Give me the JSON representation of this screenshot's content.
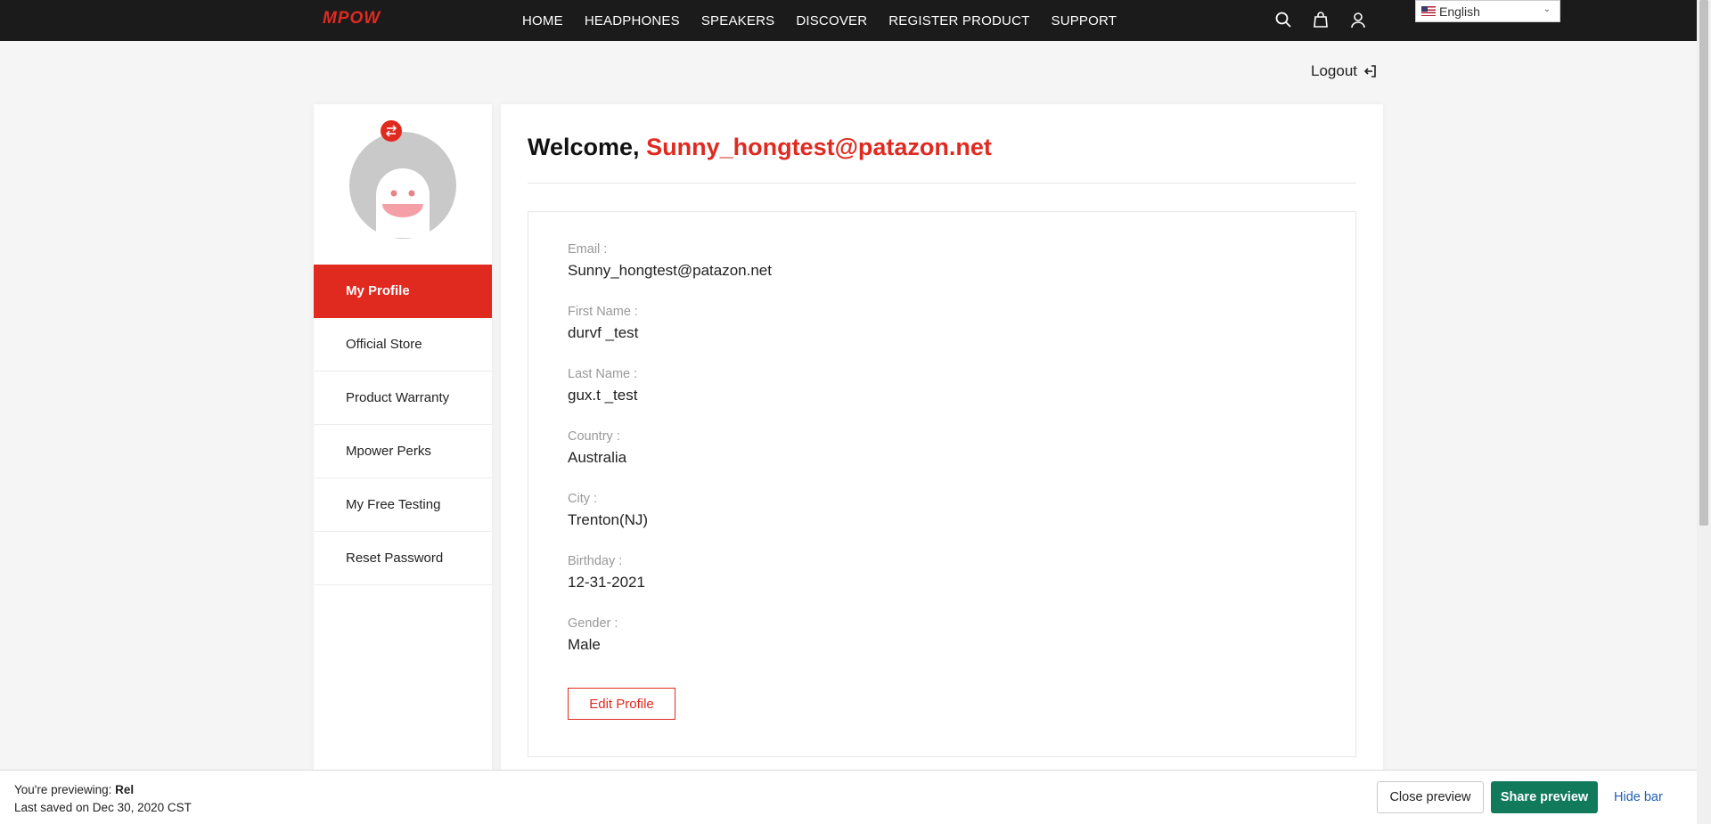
{
  "brand": {
    "logo_text": "MPOW",
    "accent": "#e02a20"
  },
  "nav": {
    "items": [
      "HOME",
      "HEADPHONES",
      "SPEAKERS",
      "DISCOVER",
      "REGISTER PRODUCT",
      "SUPPORT"
    ],
    "icons": [
      "search-icon",
      "bag-icon",
      "user-icon"
    ]
  },
  "language": {
    "selected": "English"
  },
  "account": {
    "logout_label": "Logout"
  },
  "sidebar": {
    "items": [
      {
        "label": "My Profile",
        "active": true
      },
      {
        "label": "Official Store"
      },
      {
        "label": "Product Warranty"
      },
      {
        "label": "Mpower Perks"
      },
      {
        "label": "My Free Testing"
      },
      {
        "label": "Reset Password"
      }
    ]
  },
  "main": {
    "welcome_prefix": "Welcome,",
    "username": "Sunny_hongtest@patazon.net",
    "fields": [
      {
        "label": "Email :",
        "value": "Sunny_hongtest@patazon.net"
      },
      {
        "label": "First Name :",
        "value": "durvf _test"
      },
      {
        "label": "Last Name :",
        "value": "gux.t _test"
      },
      {
        "label": "Country :",
        "value": "Australia"
      },
      {
        "label": "City :",
        "value": "Trenton(NJ)"
      },
      {
        "label": "Birthday :",
        "value": "12-31-2021"
      },
      {
        "label": "Gender :",
        "value": "Male"
      }
    ],
    "edit_label": "Edit Profile"
  },
  "preview_bar": {
    "previewing_prefix": "You're previewing:",
    "theme_name": "Rel",
    "last_saved": "Last saved on Dec 30, 2020 CST",
    "close_label": "Close preview",
    "share_label": "Share preview",
    "hide_label": "Hide bar"
  }
}
